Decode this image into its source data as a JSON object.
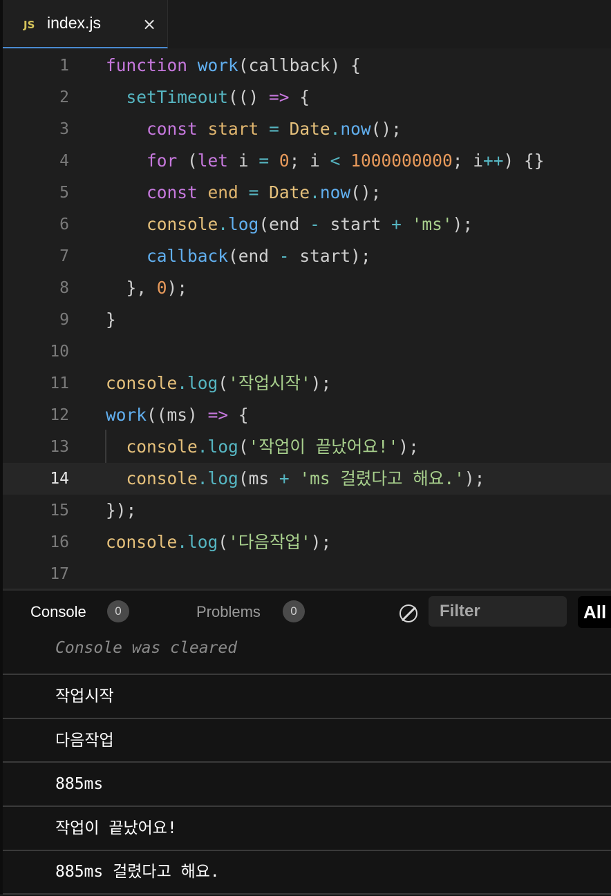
{
  "tab": {
    "icon": "JS",
    "filename": "index.js",
    "close": "×"
  },
  "editor": {
    "active_line": 14,
    "line_numbers": [
      "1",
      "2",
      "3",
      "4",
      "5",
      "6",
      "7",
      "8",
      "9",
      "10",
      "11",
      "12",
      "13",
      "14",
      "15",
      "16",
      "17"
    ],
    "tokens": {
      "function": "function",
      "work": "work",
      "callback": "callback",
      "setTimeout": "setTimeout",
      "const": "const",
      "start": "start",
      "end": "end",
      "Date": "Date",
      "now": "now",
      "for": "for",
      "let": "let",
      "i": "i",
      "zero": "0",
      "big": "1000000000",
      "console": "console",
      "log": "log",
      "ms": "ms",
      "ms_str": "'ms'",
      "s_start": "'작업시작'",
      "s_done": "'작업이 끝났어요!'",
      "s_took": "'ms 걸렸다고 해요.'",
      "s_next": "'다음작업'"
    }
  },
  "panel": {
    "tabs": [
      {
        "label": "Console",
        "count": "0"
      },
      {
        "label": "Problems",
        "count": "0"
      }
    ],
    "filter_placeholder": "Filter",
    "level_button": "All",
    "cleared_message": "Console was cleared",
    "output": [
      "작업시작",
      "다음작업",
      "885ms",
      "작업이 끝났어요!",
      "885ms 걸렸다고 해요."
    ]
  },
  "colors": {
    "keyword": "#c678dd",
    "function": "#61afef",
    "identifier": "#e5c07b",
    "number": "#e89a5b",
    "string": "#a8d08d",
    "operator": "#56b6c2",
    "tab_accent": "#4a8bd1"
  },
  "icons": [
    "js-file-icon",
    "close-icon",
    "clear-console-icon"
  ]
}
